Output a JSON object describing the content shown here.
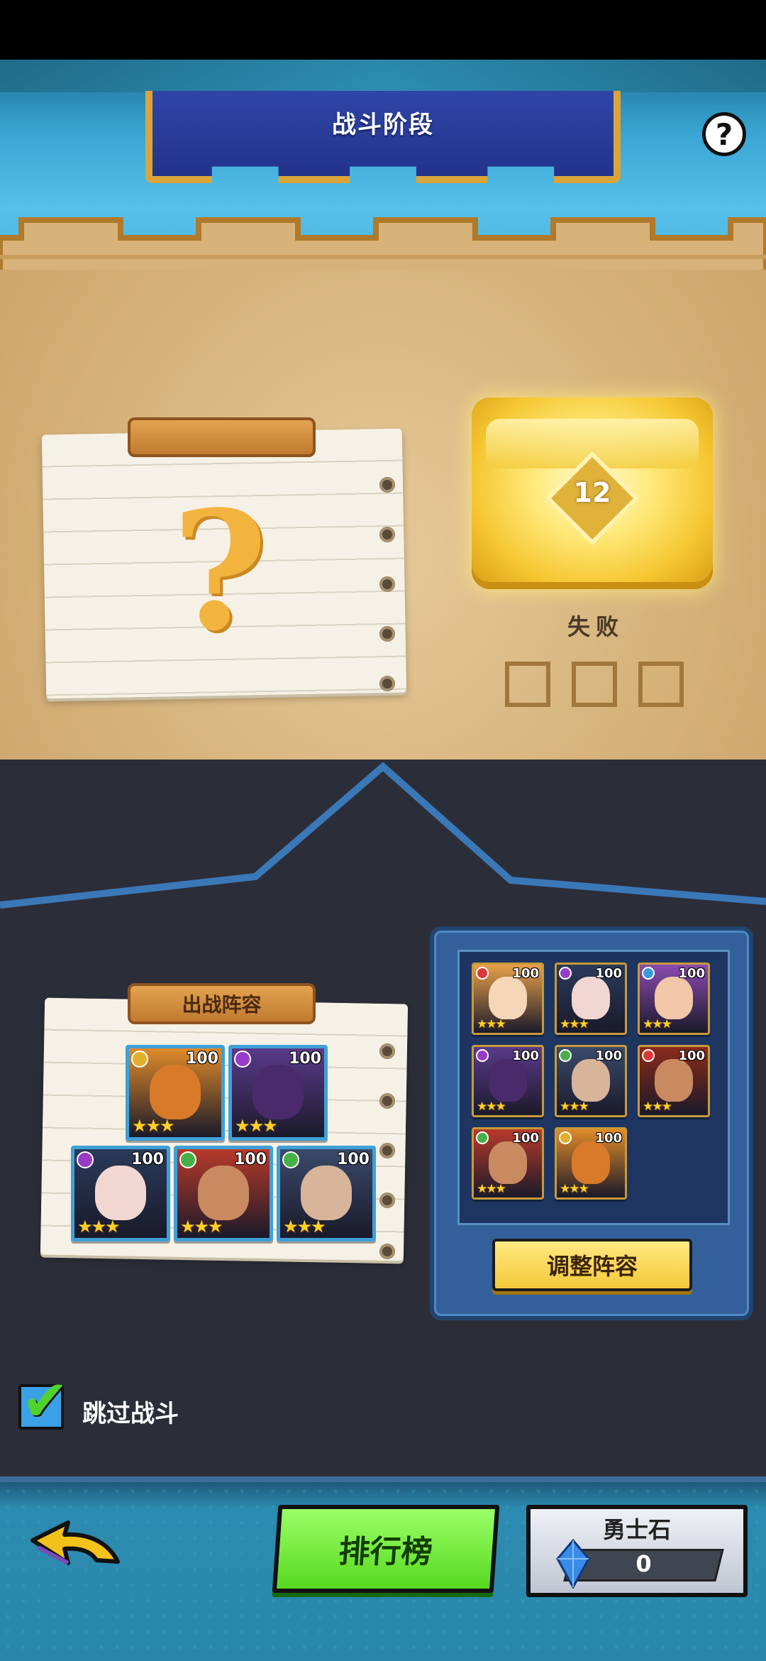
{
  "header": {
    "title": "战斗阶段",
    "help_icon": "?"
  },
  "stage": {
    "mystery_mark": "?",
    "chest_level": "12",
    "result_text": "失败",
    "result_slots": 3
  },
  "lineup": {
    "title": "出战阵容",
    "heroes": [
      {
        "name": "orange-robot",
        "level": "100",
        "stars": "★★★",
        "badge": "#e2b12b",
        "bg": "#e08a2a",
        "face": "#d87a2a"
      },
      {
        "name": "purple-demon",
        "level": "100",
        "stars": "★★★",
        "badge": "#9a3ac8",
        "bg": "#5a3a8a",
        "face": "#4a2a6a"
      },
      {
        "name": "dark-haired-girl",
        "level": "100",
        "stars": "★★★",
        "badge": "#9a3ac8",
        "bg": "#2a3a5a",
        "face": "#f2d6d2"
      },
      {
        "name": "warrior-headband",
        "level": "100",
        "stars": "★★★",
        "badge": "#48b048",
        "bg": "#b83a2a",
        "face": "#c98a62"
      },
      {
        "name": "hat-rogue",
        "level": "100",
        "stars": "★★★",
        "badge": "#48b048",
        "bg": "#3a4a6a",
        "face": "#d8b49a"
      }
    ]
  },
  "roster": {
    "heroes": [
      {
        "name": "blonde-girl",
        "level": "100",
        "stars": "★★★",
        "badge": "#d83a3a",
        "bg": "#e8a04a",
        "face": "#f6d6b8"
      },
      {
        "name": "dark-haired-girl",
        "level": "100",
        "stars": "★★★",
        "badge": "#9a3ac8",
        "bg": "#2a3a5a",
        "face": "#f2d6d2"
      },
      {
        "name": "red-haired-girl",
        "level": "100",
        "stars": "★★★",
        "badge": "#3a9ad8",
        "bg": "#8a4ab0",
        "face": "#f2c6a8"
      },
      {
        "name": "purple-demon",
        "level": "100",
        "stars": "★★★",
        "badge": "#9a3ac8",
        "bg": "#5a3a8a",
        "face": "#4a2a6a"
      },
      {
        "name": "hat-rogue",
        "level": "100",
        "stars": "★★★",
        "badge": "#48b048",
        "bg": "#3a4a6a",
        "face": "#d8b49a"
      },
      {
        "name": "bearded-warrior",
        "level": "100",
        "stars": "★★★",
        "badge": "#d83a3a",
        "bg": "#8a2a1a",
        "face": "#c98a62"
      },
      {
        "name": "warrior-headband",
        "level": "100",
        "stars": "★★★",
        "badge": "#48b048",
        "bg": "#b83a2a",
        "face": "#c98a62"
      },
      {
        "name": "orange-robot",
        "level": "100",
        "stars": "★★★",
        "badge": "#e2b12b",
        "bg": "#e08a2a",
        "face": "#d87a2a"
      }
    ],
    "adjust_label": "调整阵容"
  },
  "skip": {
    "label": "跳过战斗",
    "checked": true,
    "check_glyph": "✔"
  },
  "bottom": {
    "leaderboard_label": "排行榜",
    "currency_title": "勇士石",
    "currency_value": "0"
  },
  "colors": {
    "sky": "#3aa6d4",
    "banner": "#2f45a8",
    "gold": "#d9a53a",
    "dark_panel": "#2b2d38",
    "leaderboard_green": "#57d820"
  }
}
